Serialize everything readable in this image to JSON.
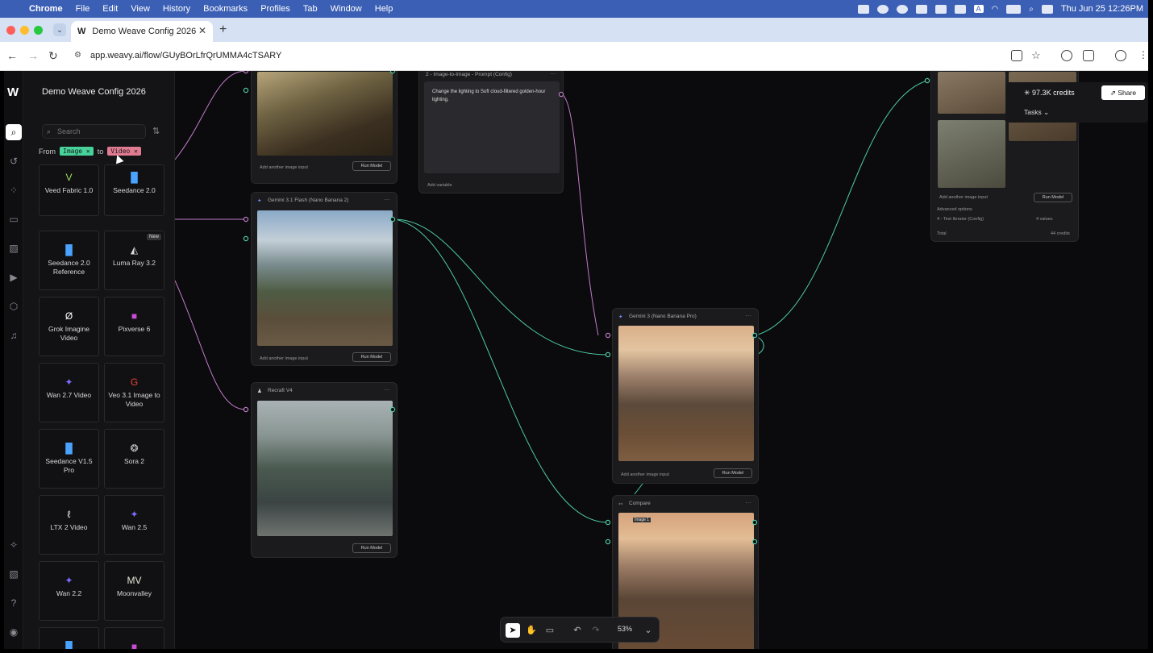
{
  "menubar": {
    "app": "Chrome",
    "items": [
      "File",
      "Edit",
      "View",
      "History",
      "Bookmarks",
      "Profiles",
      "Tab",
      "Window",
      "Help"
    ],
    "datetime": "Thu Jun 25  12:26PM",
    "input_badge": "A"
  },
  "browser": {
    "tab_title": "Demo Weave Config 2026",
    "tab_favicon": "W",
    "url": "app.weavy.ai/flow/GUyBOrLfrQrUMMA4cTSARY"
  },
  "panel": {
    "project_title": "Demo Weave Config 2026",
    "search_placeholder": "Search",
    "filter": {
      "from_label": "From",
      "from_chip": "Image",
      "to_label": "to",
      "to_chip": "Video"
    },
    "models": [
      {
        "name": "Veed Fabric 1.0",
        "icon": "veed-icon",
        "glyph": "V",
        "color": "#9be15d"
      },
      {
        "name": "Seedance 2.0",
        "icon": "bars-icon",
        "glyph": "▐▌",
        "color": "#4aa3ff"
      },
      {
        "name": "Seedance 2.0 Reference",
        "icon": "bars-icon",
        "glyph": "▐▌",
        "color": "#4aa3ff"
      },
      {
        "name": "Luma Ray 3.2",
        "icon": "luma-icon",
        "glyph": "◭",
        "color": "#dddddd",
        "badge": "New"
      },
      {
        "name": "Grok Imagine Video",
        "icon": "grok-icon",
        "glyph": "Ø",
        "color": "#ffffff"
      },
      {
        "name": "Pixverse 6",
        "icon": "pixverse-icon",
        "glyph": "■",
        "color": "#c94bd6"
      },
      {
        "name": "Wan 2.7 Video",
        "icon": "wan-icon",
        "glyph": "✦",
        "color": "#7a6cff"
      },
      {
        "name": "Veo 3.1 Image to Video",
        "icon": "google-icon",
        "glyph": "G",
        "color": "#ea4335"
      },
      {
        "name": "Seedance V1.5 Pro",
        "icon": "bars-icon",
        "glyph": "▐▌",
        "color": "#4aa3ff"
      },
      {
        "name": "Sora 2",
        "icon": "sora-icon",
        "glyph": "❂",
        "color": "#cccccc"
      },
      {
        "name": "LTX 2 Video",
        "icon": "ltx-icon",
        "glyph": "ℓ",
        "color": "#ffffff"
      },
      {
        "name": "Wan 2.5",
        "icon": "wan-icon",
        "glyph": "✦",
        "color": "#7a6cff"
      },
      {
        "name": "Wan 2.2",
        "icon": "wan-icon",
        "glyph": "✦",
        "color": "#7a6cff"
      },
      {
        "name": "Moonvalley",
        "icon": "moonvalley-icon",
        "glyph": "MV",
        "color": "#e8e8d8"
      },
      {
        "name": "",
        "icon": "bars-icon",
        "glyph": "▐▌",
        "color": "#4aa3ff"
      },
      {
        "name": "",
        "icon": "pixverse-icon",
        "glyph": "■",
        "color": "#c94bd6"
      }
    ]
  },
  "nodes": {
    "prompt": {
      "title": "2 - Image-to-Image - Prompt (Config)",
      "text": "Change the lighting to Soft cloud-filtered golden-hour lighting.",
      "add_variable": "Add variable"
    },
    "top_left": {
      "add_input": "Add another image input",
      "run": "Run Model"
    },
    "gemini31": {
      "title": "Gemini 3.1 Flash (Nano Banana 2)",
      "add_input": "Add another image input",
      "run": "Run Model"
    },
    "recraft": {
      "title": "Recraft V4",
      "run": "Run Model"
    },
    "gemini3": {
      "title": "Gemini 3 (Nano Banana Pro)",
      "add_input": "Add another image input",
      "run": "Run Model"
    },
    "compare": {
      "title": "Compare",
      "label": "Image 1"
    },
    "right": {
      "add_input": "Add another image input",
      "run": "Run Model",
      "advanced": "Advanced options",
      "iterator": "4 - Text Iterator (Config)",
      "iterator_val": "4 values",
      "total": "Total",
      "total_val": "44 credits"
    }
  },
  "topright": {
    "credits": "97.3K credits",
    "share": "Share",
    "tasks": "Tasks"
  },
  "zoom": {
    "value": "53%"
  }
}
